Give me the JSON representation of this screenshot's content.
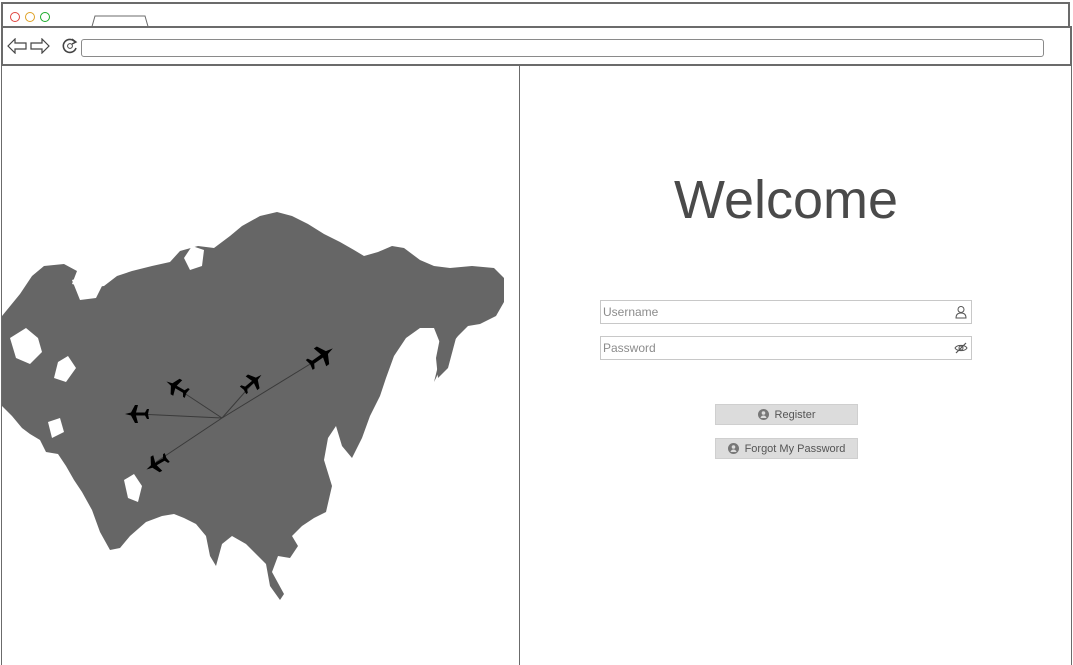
{
  "browser": {
    "window_controls": [
      "close",
      "minimize",
      "maximize"
    ],
    "icons": {
      "back": "back-arrow-icon",
      "forward": "forward-arrow-icon",
      "reload": "reload-icon"
    },
    "url": ""
  },
  "illustration": {
    "description_icon": "map-with-plane-routes",
    "map_color": "#666666",
    "plane_count": 5
  },
  "login": {
    "title": "Welcome",
    "username_placeholder": "Username",
    "password_placeholder": "Password",
    "register_label": "Register",
    "forgot_label": "Forgot My Password",
    "username_icon": "user-icon",
    "password_icon": "eye-slash-icon",
    "button_icon": "user-circle-icon"
  },
  "colors": {
    "chrome_border": "#6b6b6b",
    "button_bg": "#dcdcdc",
    "text": "#4a4a4a"
  }
}
